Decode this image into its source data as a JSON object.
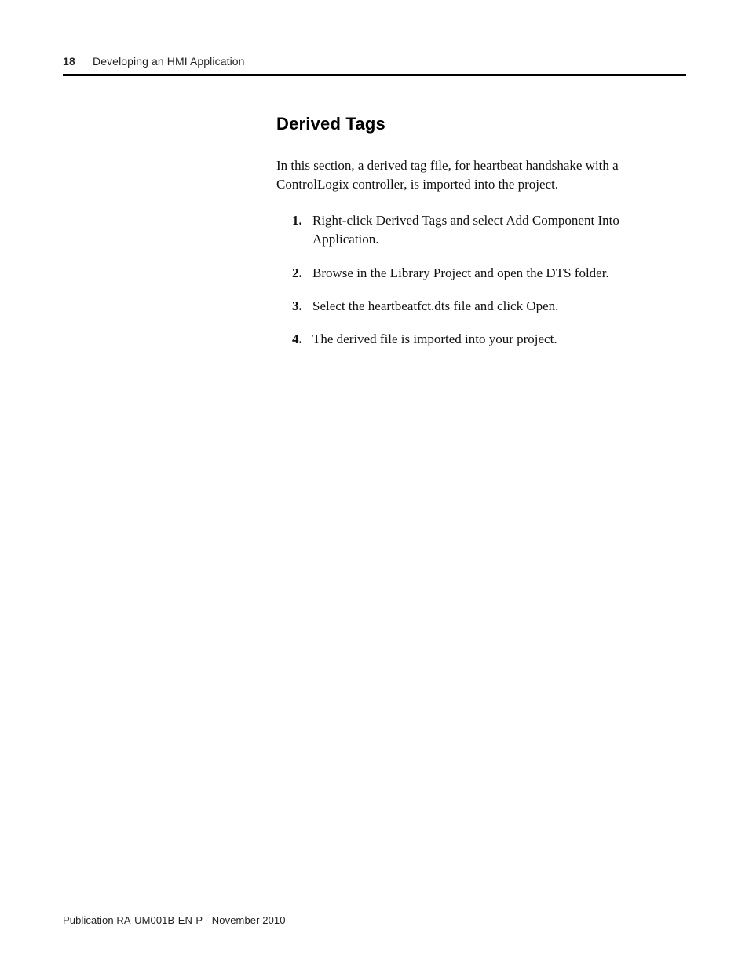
{
  "header": {
    "pageNumber": "18",
    "chapterTitle": "Developing an HMI Application"
  },
  "section": {
    "heading": "Derived Tags",
    "intro": "In this section, a derived tag file, for heartbeat handshake with a ControlLogix controller, is imported into the project.",
    "steps": [
      {
        "num": "1.",
        "text": "Right-click Derived Tags and select Add Component Into Application."
      },
      {
        "num": "2.",
        "text": "Browse in the Library Project and open the DTS folder."
      },
      {
        "num": "3.",
        "text": "Select the heartbeatfct.dts file and click Open."
      },
      {
        "num": "4.",
        "text": "The derived file is imported into your project."
      }
    ]
  },
  "footer": {
    "publication": "Publication RA-UM001B-EN-P - November 2010"
  }
}
